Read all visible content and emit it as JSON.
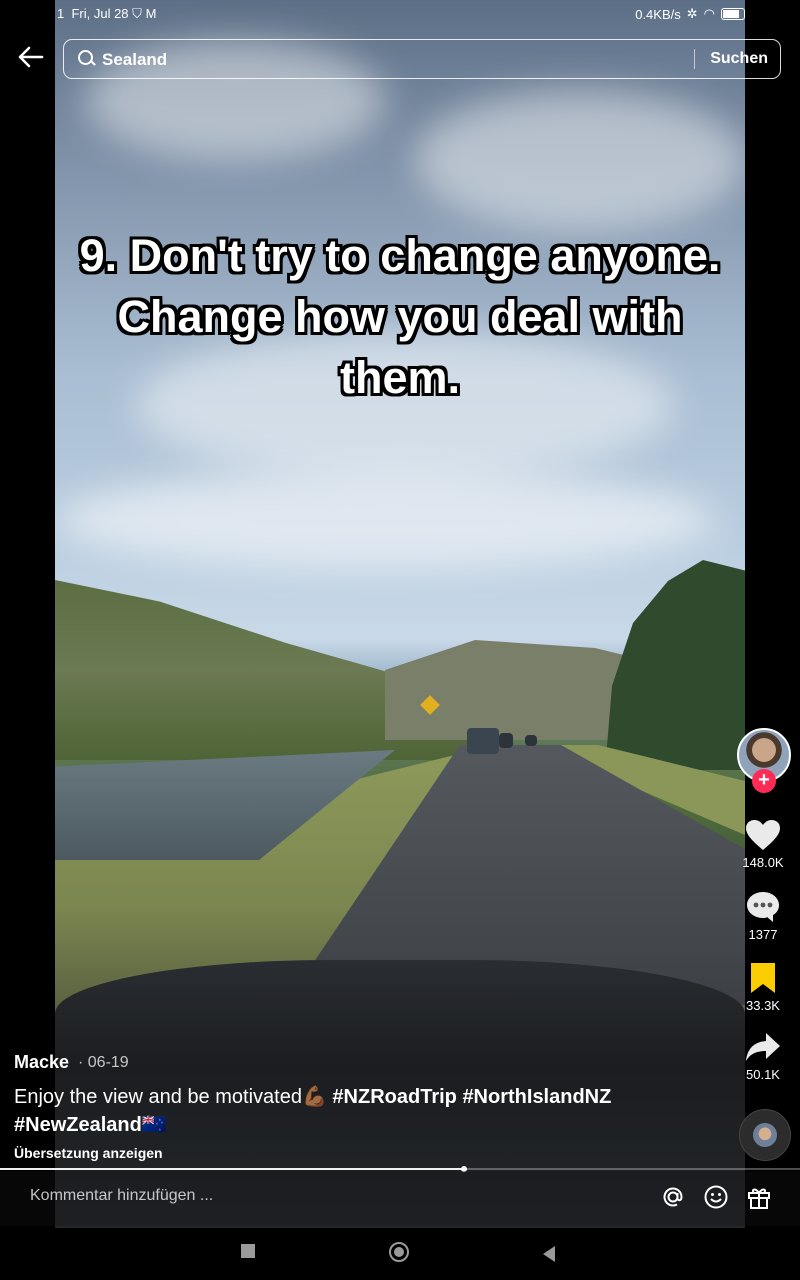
{
  "status_bar": {
    "time": "1",
    "date": "Fri, Jul 28",
    "speed": "0.4KB/s"
  },
  "search": {
    "query": "Sealand",
    "button": "Suchen"
  },
  "video": {
    "overlay_text": "9. Don't try to change anyone. Change how you deal with them."
  },
  "rail": {
    "likes": "148.0K",
    "comments": "1377",
    "saves": "33.3K",
    "shares": "50.1K",
    "follow_symbol": "+"
  },
  "caption": {
    "author": "Macke",
    "date": "· 06-19",
    "text": "Enjoy the view and be motivated💪🏾 ",
    "tags": [
      "#NZRoadTrip",
      "#NorthIslandNZ",
      "#NewZealand🇳🇿"
    ],
    "translate": "Übersetzung anzeigen"
  },
  "progress": {
    "fraction": 0.58
  },
  "comment_bar": {
    "placeholder": "Kommentar hinzufügen ..."
  },
  "icons": [
    "back-arrow-icon",
    "search-icon",
    "heart-icon",
    "comment-icon",
    "bookmark-icon",
    "share-icon",
    "at-icon",
    "emoji-icon",
    "gift-icon"
  ],
  "colors": {
    "accent": "#fe2c55",
    "bookmark": "#facd00"
  }
}
